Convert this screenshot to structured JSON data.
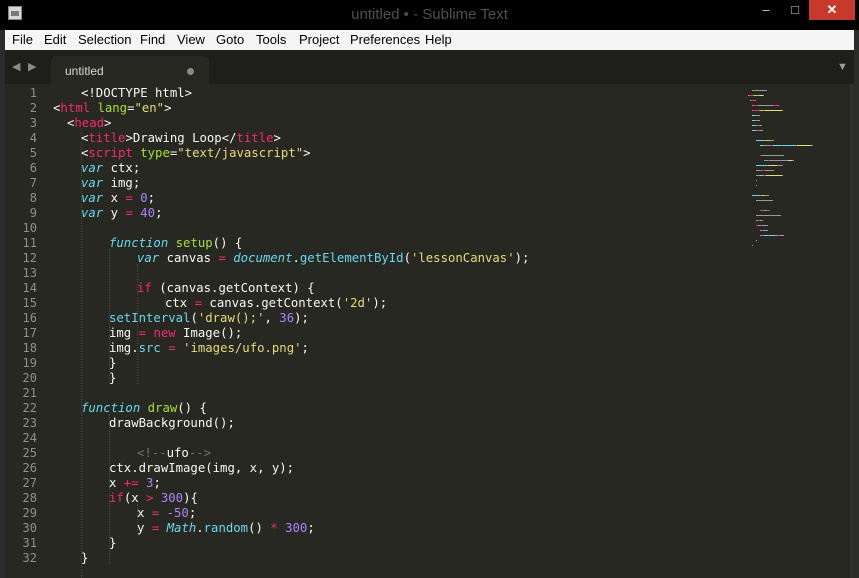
{
  "window": {
    "title": "untitled • - Sublime Text",
    "minimize_glyph": "‒",
    "maximize_glyph": "□",
    "close_glyph": "✕"
  },
  "menu": [
    "File",
    "Edit",
    "Selection",
    "Find",
    "View",
    "Goto",
    "Tools",
    "Project",
    "Preferences",
    "Help"
  ],
  "tabs": [
    {
      "label": "untitled",
      "modified": true
    }
  ],
  "nav": {
    "back": "◀",
    "forward": "▶",
    "dropdown": "▼"
  },
  "line_numbers": [
    "1",
    "2",
    "3",
    "4",
    "5",
    "6",
    "7",
    "8",
    "9",
    "10",
    "11",
    "12",
    "13",
    "14",
    "15",
    "16",
    "17",
    "18",
    "19",
    "20",
    "21",
    "22",
    "23",
    "24",
    "25",
    "26",
    "27",
    "28",
    "29",
    "30",
    "31",
    "32"
  ],
  "code": [
    [
      {
        "t": "txt",
        "s": "<!DOCTYPE html>"
      }
    ],
    [
      {
        "t": "txt",
        "s": "<"
      },
      {
        "t": "tag",
        "s": "html"
      },
      {
        "t": "txt",
        "s": " "
      },
      {
        "t": "attr",
        "s": "lang"
      },
      {
        "t": "txt",
        "s": "="
      },
      {
        "t": "str",
        "s": "\"en\""
      },
      {
        "t": "txt",
        "s": ">"
      }
    ],
    [
      {
        "t": "txt",
        "s": "<"
      },
      {
        "t": "tag",
        "s": "head"
      },
      {
        "t": "txt",
        "s": ">"
      }
    ],
    [
      {
        "t": "txt",
        "s": "<"
      },
      {
        "t": "tag",
        "s": "title"
      },
      {
        "t": "txt",
        "s": ">Drawing Loop</"
      },
      {
        "t": "tag",
        "s": "title"
      },
      {
        "t": "txt",
        "s": ">"
      }
    ],
    [
      {
        "t": "txt",
        "s": "<"
      },
      {
        "t": "tag",
        "s": "script"
      },
      {
        "t": "txt",
        "s": " "
      },
      {
        "t": "attr",
        "s": "type"
      },
      {
        "t": "txt",
        "s": "="
      },
      {
        "t": "str",
        "s": "\"text/javascript\""
      },
      {
        "t": "txt",
        "s": ">"
      }
    ],
    [
      {
        "t": "kw",
        "s": "var"
      },
      {
        "t": "txt",
        "s": " ctx;"
      }
    ],
    [
      {
        "t": "kw",
        "s": "var"
      },
      {
        "t": "txt",
        "s": " img;"
      }
    ],
    [
      {
        "t": "kw",
        "s": "var"
      },
      {
        "t": "txt",
        "s": " x "
      },
      {
        "t": "op",
        "s": "="
      },
      {
        "t": "txt",
        "s": " "
      },
      {
        "t": "num",
        "s": "0"
      },
      {
        "t": "txt",
        "s": ";"
      }
    ],
    [
      {
        "t": "kw",
        "s": "var"
      },
      {
        "t": "txt",
        "s": " y "
      },
      {
        "t": "op",
        "s": "="
      },
      {
        "t": "txt",
        "s": " "
      },
      {
        "t": "num",
        "s": "40"
      },
      {
        "t": "txt",
        "s": ";"
      }
    ],
    [],
    [
      {
        "t": "kw",
        "s": "function"
      },
      {
        "t": "txt",
        "s": " "
      },
      {
        "t": "fn",
        "s": "setup"
      },
      {
        "t": "txt",
        "s": "() {"
      }
    ],
    [
      {
        "t": "kw",
        "s": "var"
      },
      {
        "t": "txt",
        "s": " canvas "
      },
      {
        "t": "op",
        "s": "="
      },
      {
        "t": "txt",
        "s": " "
      },
      {
        "t": "obj",
        "s": "document"
      },
      {
        "t": "txt",
        "s": "."
      },
      {
        "t": "prop",
        "s": "getElementById"
      },
      {
        "t": "txt",
        "s": "("
      },
      {
        "t": "str",
        "s": "'lessonCanvas'"
      },
      {
        "t": "txt",
        "s": ");"
      }
    ],
    [],
    [
      {
        "t": "op",
        "s": "if"
      },
      {
        "t": "txt",
        "s": " (canvas.getContext) {"
      }
    ],
    [
      {
        "t": "txt",
        "s": "ctx "
      },
      {
        "t": "op",
        "s": "="
      },
      {
        "t": "txt",
        "s": " canvas.getContext("
      },
      {
        "t": "str",
        "s": "'2d'"
      },
      {
        "t": "txt",
        "s": ");"
      }
    ],
    [
      {
        "t": "prop",
        "s": "setInterval"
      },
      {
        "t": "txt",
        "s": "("
      },
      {
        "t": "str",
        "s": "'draw();'"
      },
      {
        "t": "txt",
        "s": ", "
      },
      {
        "t": "num",
        "s": "36"
      },
      {
        "t": "txt",
        "s": ");"
      }
    ],
    [
      {
        "t": "txt",
        "s": "img "
      },
      {
        "t": "op",
        "s": "="
      },
      {
        "t": "txt",
        "s": " "
      },
      {
        "t": "op",
        "s": "new"
      },
      {
        "t": "txt",
        "s": " Image();"
      }
    ],
    [
      {
        "t": "txt",
        "s": "img."
      },
      {
        "t": "prop",
        "s": "src"
      },
      {
        "t": "txt",
        "s": " "
      },
      {
        "t": "op",
        "s": "="
      },
      {
        "t": "txt",
        "s": " "
      },
      {
        "t": "str",
        "s": "'images/ufo.png'"
      },
      {
        "t": "txt",
        "s": ";"
      }
    ],
    [
      {
        "t": "txt",
        "s": "}"
      }
    ],
    [
      {
        "t": "txt",
        "s": "}"
      }
    ],
    [],
    [
      {
        "t": "kw",
        "s": "function"
      },
      {
        "t": "txt",
        "s": " "
      },
      {
        "t": "fn",
        "s": "draw"
      },
      {
        "t": "txt",
        "s": "() {"
      }
    ],
    [
      {
        "t": "txt",
        "s": "drawBackground();"
      }
    ],
    [],
    [
      {
        "t": "cmt",
        "s": "<!--"
      },
      {
        "t": "txt",
        "s": "ufo"
      },
      {
        "t": "cmt",
        "s": "-->"
      }
    ],
    [
      {
        "t": "txt",
        "s": "ctx.drawImage(img, x, y);"
      }
    ],
    [
      {
        "t": "txt",
        "s": "x "
      },
      {
        "t": "op",
        "s": "+="
      },
      {
        "t": "txt",
        "s": " "
      },
      {
        "t": "num",
        "s": "3"
      },
      {
        "t": "txt",
        "s": ";"
      }
    ],
    [
      {
        "t": "op",
        "s": "if"
      },
      {
        "t": "txt",
        "s": "(x "
      },
      {
        "t": "op",
        "s": ">"
      },
      {
        "t": "txt",
        "s": " "
      },
      {
        "t": "num",
        "s": "300"
      },
      {
        "t": "txt",
        "s": "){"
      }
    ],
    [
      {
        "t": "txt",
        "s": "x "
      },
      {
        "t": "op",
        "s": "="
      },
      {
        "t": "txt",
        "s": " "
      },
      {
        "t": "num",
        "s": "-50"
      },
      {
        "t": "txt",
        "s": ";"
      }
    ],
    [
      {
        "t": "txt",
        "s": "y "
      },
      {
        "t": "op",
        "s": "="
      },
      {
        "t": "txt",
        "s": " "
      },
      {
        "t": "obj",
        "s": "Math"
      },
      {
        "t": "txt",
        "s": "."
      },
      {
        "t": "prop",
        "s": "random"
      },
      {
        "t": "txt",
        "s": "() "
      },
      {
        "t": "op",
        "s": "*"
      },
      {
        "t": "txt",
        "s": " "
      },
      {
        "t": "num",
        "s": "300"
      },
      {
        "t": "txt",
        "s": ";"
      }
    ],
    [
      {
        "t": "txt",
        "s": "}"
      }
    ],
    [
      {
        "t": "txt",
        "s": "}"
      }
    ]
  ],
  "colors": {
    "background": "#272822",
    "gutter_text": "#8f908a",
    "keyword": "#66d9ef",
    "tag": "#f92672",
    "string": "#e6db74",
    "number": "#ae81ff",
    "function": "#a6e22e",
    "comment": "#75715e",
    "close_button": "#c7392b"
  }
}
